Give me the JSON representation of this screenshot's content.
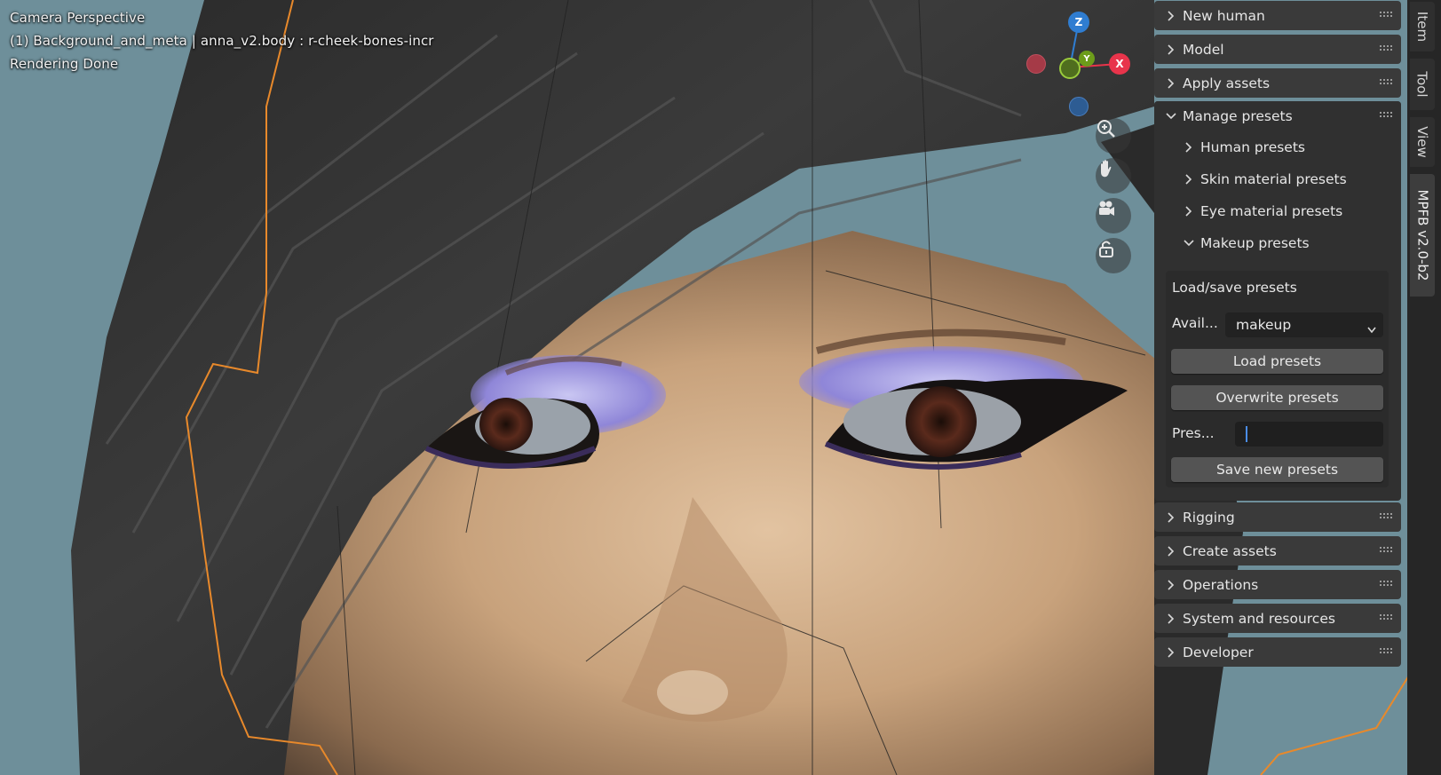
{
  "viewport": {
    "line1": "Camera Perspective",
    "line2": "(1) Background_and_meta | anna_v2.body : r-cheek-bones-incr",
    "line3": "Rendering Done",
    "gizmo": {
      "z": "Z",
      "y": "Y",
      "x": "X"
    },
    "nav_icons": [
      "zoom-icon",
      "hand-icon",
      "camera-icon",
      "lock-icon"
    ]
  },
  "sidebar": {
    "sections": [
      {
        "label": "New human",
        "expanded": false
      },
      {
        "label": "Model",
        "expanded": false
      },
      {
        "label": "Apply assets",
        "expanded": false
      },
      {
        "label": "Manage presets",
        "expanded": true
      }
    ],
    "manage_presets": {
      "sub": [
        {
          "label": "Human presets",
          "expanded": false
        },
        {
          "label": "Skin material presets",
          "expanded": false
        },
        {
          "label": "Eye material presets",
          "expanded": false
        },
        {
          "label": "Makeup presets",
          "expanded": true
        }
      ],
      "makeup": {
        "title": "Load/save presets",
        "avail_label": "Avail...",
        "avail_value": "makeup",
        "load_button": "Load presets",
        "overwrite_button": "Overwrite presets",
        "pres_label": "Pres...",
        "pres_value": "",
        "save_button": "Save new presets"
      }
    },
    "sections_after": [
      {
        "label": "Rigging"
      },
      {
        "label": "Create assets"
      },
      {
        "label": "Operations"
      },
      {
        "label": "System and resources"
      },
      {
        "label": "Developer"
      }
    ]
  },
  "tabs": [
    "Item",
    "Tool",
    "View",
    "MPFB v2.0-b2"
  ],
  "active_tab": "MPFB v2.0-b2",
  "colors": {
    "panel": "#3a3a3a",
    "button": "#545454",
    "axis_x": "#e8344b",
    "axis_y": "#7ab31c",
    "axis_z": "#2f7dd1"
  }
}
